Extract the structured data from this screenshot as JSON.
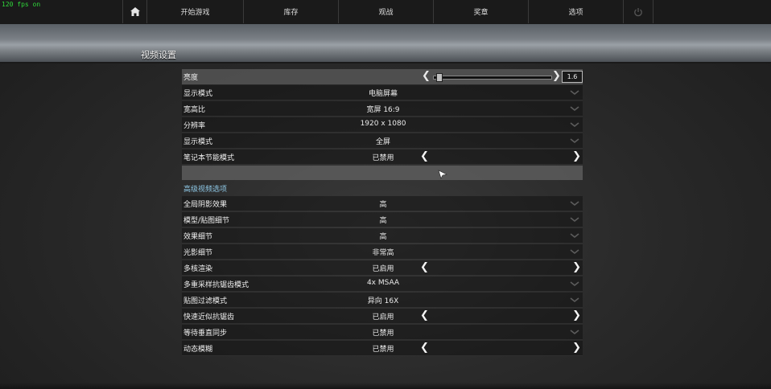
{
  "fps": "120 fps on",
  "nav": {
    "home_icon": "home-icon",
    "items": [
      {
        "label": "开始游戏"
      },
      {
        "label": "库存"
      },
      {
        "label": "观战"
      },
      {
        "label": "奖章"
      },
      {
        "label": "选项"
      }
    ],
    "power_icon": "power-icon"
  },
  "page_title": "视频设置",
  "brightness": {
    "label": "亮度",
    "value": "1.6",
    "level": 0.02
  },
  "rows_top": [
    {
      "label": "显示模式",
      "value": "电脑屏幕",
      "control": "dropdown"
    },
    {
      "label": "宽高比",
      "value": "宽屏 16:9",
      "control": "dropdown"
    },
    {
      "label": "分辨率",
      "value": "1920 x 1080",
      "control": "dropdown"
    },
    {
      "label": "显示模式",
      "value": "全屏",
      "control": "dropdown"
    },
    {
      "label": "笔记本节能模式",
      "value": "已禁用",
      "control": "toggle"
    }
  ],
  "advanced_header": "高级视频选项",
  "rows_advanced": [
    {
      "label": "全局阴影效果",
      "value": "高",
      "control": "dropdown"
    },
    {
      "label": "模型/贴图细节",
      "value": "高",
      "control": "dropdown"
    },
    {
      "label": "效果细节",
      "value": "高",
      "control": "dropdown"
    },
    {
      "label": "光影细节",
      "value": "非常高",
      "control": "dropdown"
    },
    {
      "label": "多核渲染",
      "value": "已启用",
      "control": "toggle"
    },
    {
      "label": "多重采样抗锯齿模式",
      "value": "4x MSAA",
      "control": "dropdown"
    },
    {
      "label": "贴图过滤模式",
      "value": "异向 16X",
      "control": "dropdown"
    },
    {
      "label": "快速近似抗锯齿",
      "value": "已启用",
      "control": "toggle"
    },
    {
      "label": "等待垂直同步",
      "value": "已禁用",
      "control": "dropdown"
    },
    {
      "label": "动态模糊",
      "value": "已禁用",
      "control": "toggle"
    }
  ],
  "colors": {
    "accent": "#8ec8e6",
    "fps": "#2fd93a"
  }
}
